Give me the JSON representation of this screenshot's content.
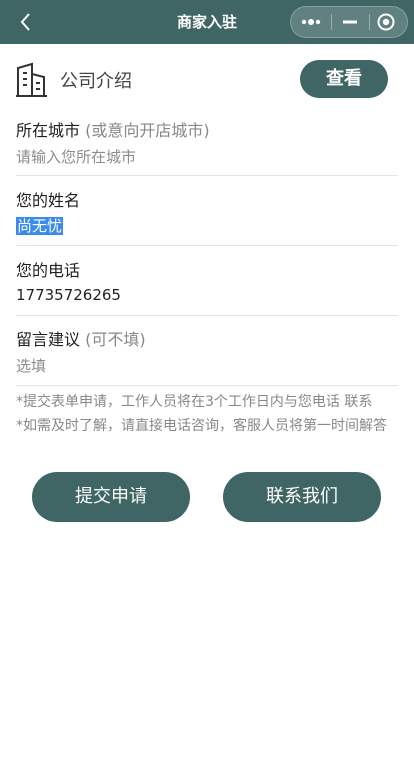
{
  "nav": {
    "title": "商家入驻",
    "back_icon": "chevron-left-icon",
    "menu_icon": "more-dots-icon",
    "minimize_icon": "minimize-icon",
    "close_icon": "target-circle-icon"
  },
  "intro": {
    "label": "公司介绍",
    "view_label": "查看",
    "icon": "building-icon"
  },
  "form": {
    "city": {
      "label": "所在城市",
      "hint": "(或意向开店城市)",
      "placeholder": "请输入您所在城市"
    },
    "name": {
      "label": "您的姓名",
      "value": "尚无忧"
    },
    "phone": {
      "label": "您的电话",
      "value": "17735726265"
    },
    "message": {
      "label": "留言建议",
      "hint": "(可不填)",
      "placeholder": "选填"
    }
  },
  "notes": {
    "line1": "*提交表单申请，工作人员将在3个工作日内与您电话 联系",
    "line2": "*如需及时了解，请直接电话咨询，客服人员将第一时间解答"
  },
  "buttons": {
    "submit_label": "提交申请",
    "contact_label": "联系我们"
  },
  "colors": {
    "primary": "#3f6664",
    "selection": "#3b8bec"
  }
}
